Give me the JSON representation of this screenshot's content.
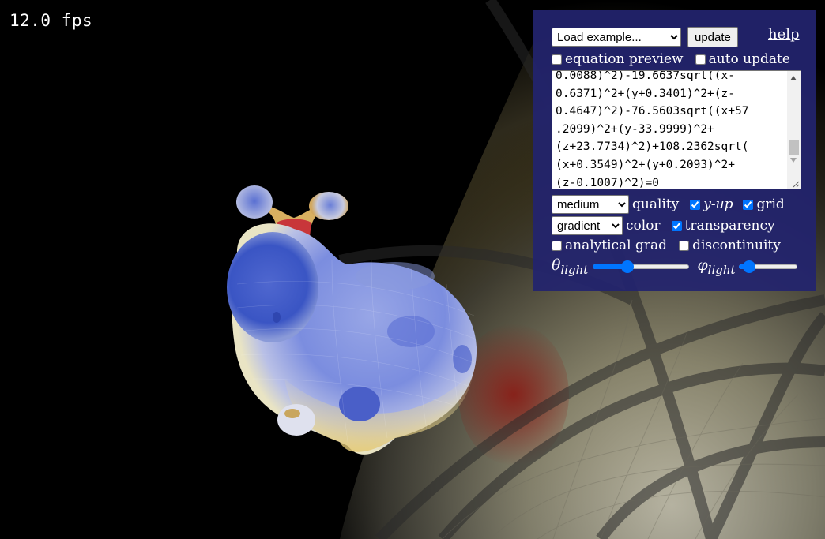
{
  "stats": {
    "fps": "12.0 fps"
  },
  "controls": {
    "example_select": {
      "value": "Load example...",
      "options": [
        "Load example..."
      ]
    },
    "update_button": "update",
    "help_link": "help",
    "equation_preview": {
      "label": "equation preview",
      "checked": false
    },
    "auto_update": {
      "label": "auto update",
      "checked": false
    },
    "equation_lines": [
      "0.0088)^2)-19.6637sqrt((x-",
      "0.6371)^2+(y+0.3401)^2+(z-",
      "0.4647)^2)-76.5603sqrt((x+57",
      ".2099)^2+(y-33.9999)^2+",
      "(z+23.7734)^2)+108.2362sqrt(",
      "(x+0.3549)^2+(y+0.2093)^2+",
      "(z-0.1007)^2)=0"
    ],
    "quality_select": {
      "value": "medium",
      "label": "quality"
    },
    "y_up": {
      "label": "y-up",
      "checked": true
    },
    "grid": {
      "label": "grid",
      "checked": true
    },
    "color_select": {
      "value": "gradient",
      "label": "color"
    },
    "transparency": {
      "label": "transparency",
      "checked": true
    },
    "analytical_grad": {
      "label": "analytical grad",
      "checked": false
    },
    "discontinuity": {
      "label": "discontinuity",
      "checked": false
    },
    "theta_light": {
      "symbol": "θ",
      "subscript": "light",
      "level": 0.36
    },
    "phi_light": {
      "symbol": "φ",
      "subscript": "light",
      "level": 0.18
    }
  },
  "colors": {
    "panel": "#22246e",
    "accent": "#0075ff",
    "surface_blue": "#4a63c8",
    "surface_yellow": "#d8c27a",
    "surface_red": "#c8282a"
  }
}
